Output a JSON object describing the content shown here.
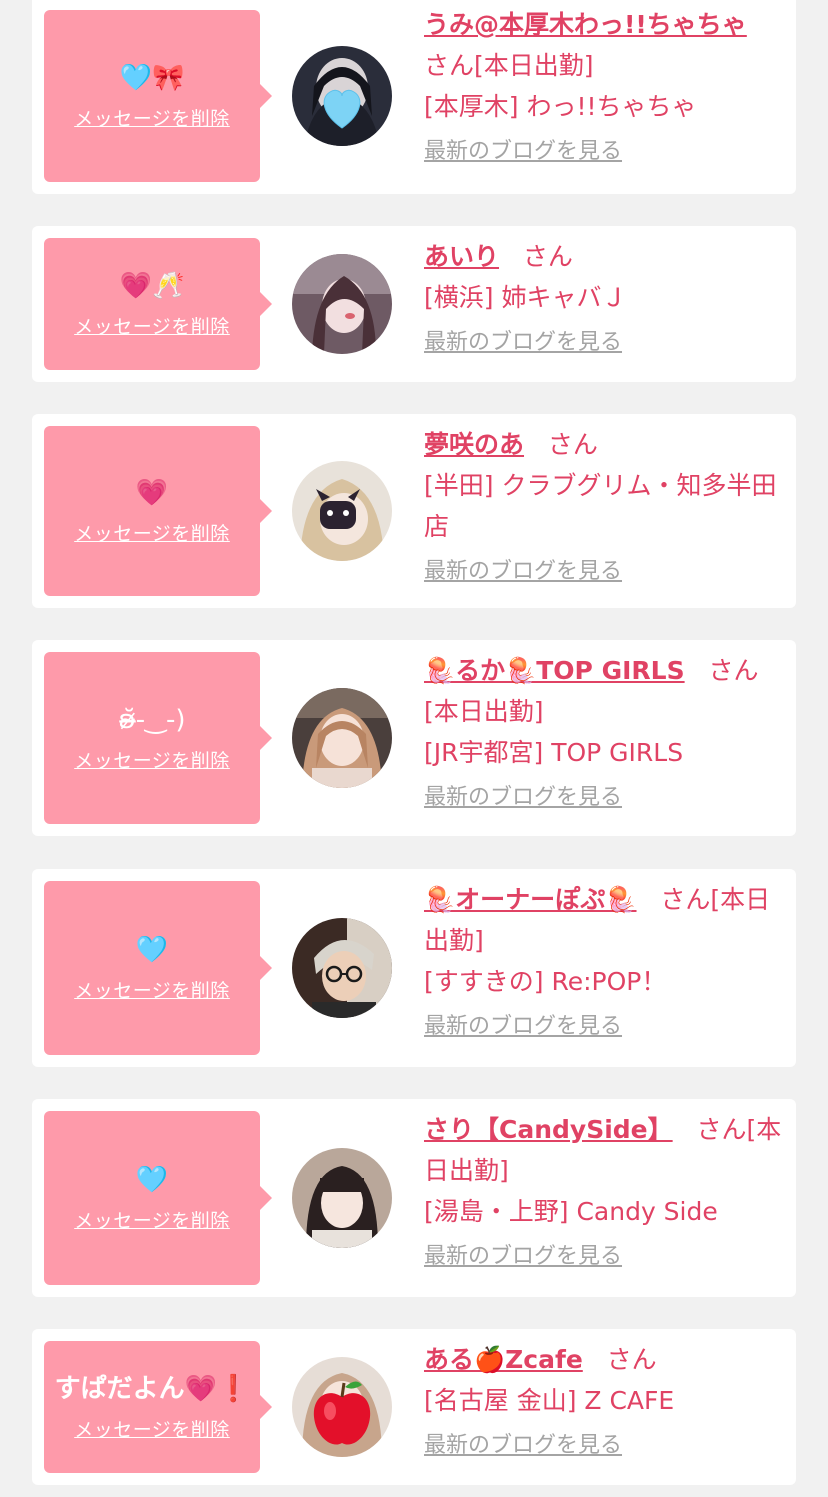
{
  "colors": {
    "page_bg": "#f1f1f1",
    "card_bg": "#ffffff",
    "bubble_bg": "#fe9aaa",
    "name": "#e04264",
    "blog_link": "#a4a4a4"
  },
  "items": [
    {
      "message": "🩵🎀",
      "delete_label": "メッセージを削除",
      "name": "うみ@本厚木わっ!!ちゃちゃ",
      "san": "さん",
      "status": "[本日出勤]",
      "shop": "[本厚木] わっ!!ちゃちゃ",
      "blog_label": "最新のブログを見る",
      "avatar_icon": "heart-sticker-icon"
    },
    {
      "message": "💗🥂",
      "delete_label": "メッセージを削除",
      "name": "あいり",
      "san": "さん",
      "status": "",
      "shop": "[横浜] 姉キャバＪ",
      "blog_label": "最新のブログを見る"
    },
    {
      "message": "💗",
      "delete_label": "メッセージを削除",
      "name": "夢咲のあ",
      "san": "さん",
      "status": "",
      "shop": "[半田] クラブグリム・知多半田店",
      "blog_label": "最新のブログを見る"
    },
    {
      "message": "ʚ̴̶̷̆-‿-)",
      "delete_label": "メッセージを削除",
      "name": "🪼るか🪼TOP GIRLS",
      "san": "さん",
      "status": "[本日出勤]",
      "shop": "[JR宇都宮] TOP GIRLS",
      "blog_label": "最新のブログを見る"
    },
    {
      "message": "🩵",
      "delete_label": "メッセージを削除",
      "name": "🪼オーナーぽぷ🪼",
      "san": "さん",
      "status": "[本日出勤]",
      "shop": "[すすきの] Re:POP！",
      "blog_label": "最新のブログを見る"
    },
    {
      "message": "🩵",
      "delete_label": "メッセージを削除",
      "name": "さり【CandySide】",
      "san": "さん",
      "status": "[本日出勤]",
      "shop": "[湯島・上野] Candy Side",
      "blog_label": "最新のブログを見る"
    },
    {
      "message": "すぱだよん💗❗",
      "delete_label": "メッセージを削除",
      "name": "ある🍎Zcafe",
      "san": "さん",
      "status": "",
      "shop": "[名古屋 金山] Z CAFE",
      "blog_label": "最新のブログを見る",
      "avatar_icon": "apple-sticker-icon"
    }
  ]
}
